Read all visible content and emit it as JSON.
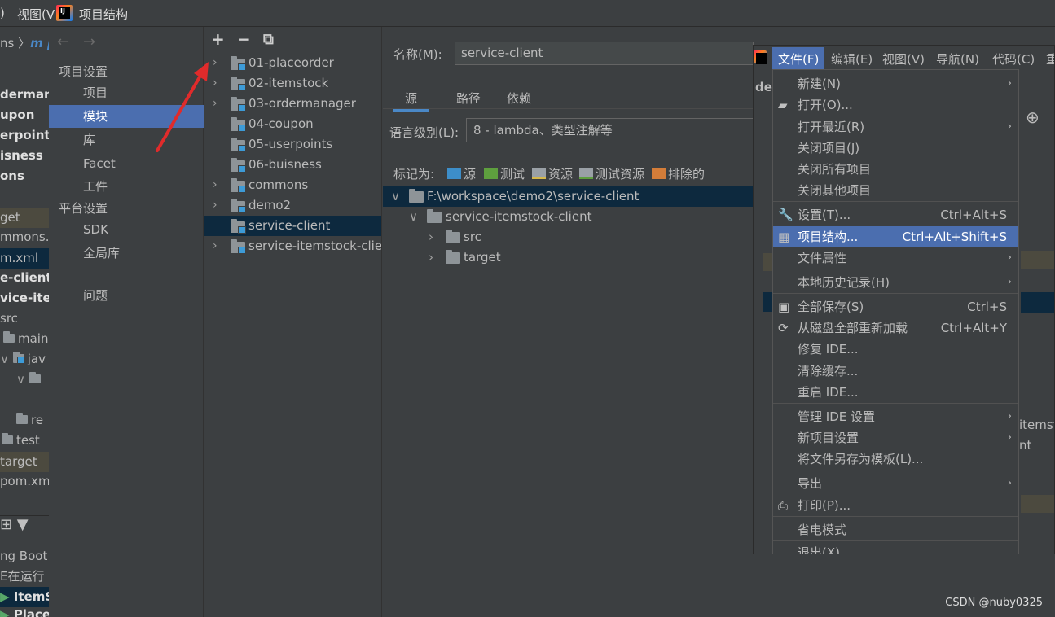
{
  "topbar": {
    "items": [
      ")",
      "视图(V"
    ],
    "title": "项目结构"
  },
  "bg_ide": {
    "crumb_a": "ns",
    "crumb_b": "m p",
    "lines": [
      "dermana",
      "upon",
      "erpoints",
      "isness",
      "ons",
      "get",
      "mmons.i",
      "m.xml",
      "e-client",
      "vice-iter",
      "src",
      "main",
      "jav",
      "re",
      "test",
      "target",
      "pom.xm",
      "ng Boot",
      "E在运行",
      "ItemS",
      "PlaceO"
    ]
  },
  "nav": {
    "back": "←",
    "forward": "→",
    "project_settings": "项目设置",
    "project": "项目",
    "modules": "模块",
    "libraries": "库",
    "facets": "Facet",
    "artifacts": "工件",
    "platform_settings": "平台设置",
    "sdk": "SDK",
    "global_libs": "全局库",
    "problems": "问题"
  },
  "modtoolbar": {
    "add": "+",
    "remove": "−",
    "copy": "⧉"
  },
  "modules": [
    "01-placeorder",
    "02-itemstock",
    "03-ordermanager",
    "04-coupon",
    "05-userpoints",
    "06-buisness",
    "commons",
    "demo2",
    "service-client",
    "service-itemstock-client"
  ],
  "detail": {
    "name_label": "名称(M):",
    "name_value": "service-client",
    "tabs": [
      "源",
      "路径",
      "依赖"
    ],
    "lang_label": "语言级别(L):",
    "lang_value": "8 - lambda、类型注解等",
    "mark_label": "标记为:",
    "marks": [
      "源",
      "测试",
      "资源",
      "测试资源",
      "排除的"
    ],
    "tree": [
      "F:\\workspace\\demo2\\service-client",
      "service-itemstock-client",
      "src",
      "target"
    ]
  },
  "menubar": [
    "文件(F)",
    "编辑(E)",
    "视图(V)",
    "导航(N)",
    "代码(C)",
    "重"
  ],
  "file_menu": [
    {
      "label": "新建(N)",
      "shortcut": "",
      "sub": true
    },
    {
      "label": "打开(O)...",
      "shortcut": ""
    },
    {
      "label": "打开最近(R)",
      "shortcut": "",
      "sub": true
    },
    {
      "label": "关闭项目(J)",
      "shortcut": ""
    },
    {
      "label": "关闭所有项目",
      "shortcut": ""
    },
    {
      "label": "关闭其他项目",
      "shortcut": ""
    },
    {
      "label": "设置(T)...",
      "shortcut": "Ctrl+Alt+S"
    },
    {
      "label": "项目结构...",
      "shortcut": "Ctrl+Alt+Shift+S"
    },
    {
      "label": "文件属性",
      "shortcut": "",
      "sub": true
    },
    {
      "label": "本地历史记录(H)",
      "shortcut": "",
      "sub": true
    },
    {
      "label": "全部保存(S)",
      "shortcut": "Ctrl+S"
    },
    {
      "label": "从磁盘全部重新加载",
      "shortcut": "Ctrl+Alt+Y"
    },
    {
      "label": "修复 IDE...",
      "shortcut": ""
    },
    {
      "label": "清除缓存...",
      "shortcut": ""
    },
    {
      "label": "重启 IDE...",
      "shortcut": ""
    },
    {
      "label": "管理 IDE 设置",
      "shortcut": "",
      "sub": true
    },
    {
      "label": "新项目设置",
      "shortcut": "",
      "sub": true
    },
    {
      "label": "将文件另存为模板(L)...",
      "shortcut": ""
    },
    {
      "label": "导出",
      "shortcut": "",
      "sub": true
    },
    {
      "label": "打印(P)...",
      "shortcut": ""
    },
    {
      "label": "省电模式",
      "shortcut": ""
    },
    {
      "label": "退出(X)",
      "shortcut": ""
    }
  ],
  "bg_right": {
    "a": "der",
    "b": "itemst",
    "c": "nt"
  },
  "watermark": "CSDN @nuby0325",
  "colors": {
    "selection": "#4b6eaf",
    "sel_tree": "#0d293e",
    "bg": "#3c3f41",
    "arrow": "#e02b2b"
  }
}
